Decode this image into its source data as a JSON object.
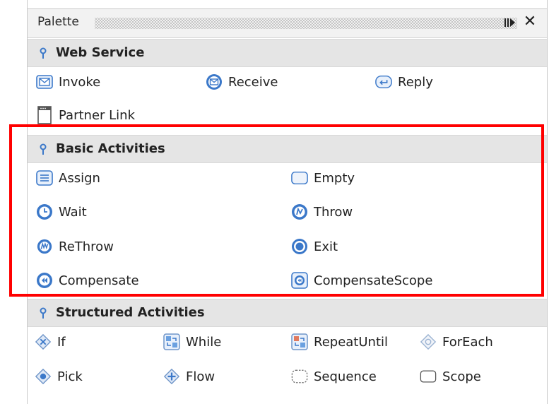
{
  "palette": {
    "title": "Palette",
    "categories": [
      {
        "label": "Web Service",
        "items": [
          {
            "label": "Invoke",
            "icon": "invoke-icon"
          },
          {
            "label": "Receive",
            "icon": "receive-icon"
          },
          {
            "label": "Reply",
            "icon": "reply-icon"
          },
          {
            "label": "Partner Link",
            "icon": "partner-link-icon"
          }
        ]
      },
      {
        "label": "Basic Activities",
        "items": [
          {
            "label": "Assign",
            "icon": "assign-icon"
          },
          {
            "label": "Empty",
            "icon": "empty-icon"
          },
          {
            "label": "Wait",
            "icon": "wait-icon"
          },
          {
            "label": "Throw",
            "icon": "throw-icon"
          },
          {
            "label": "ReThrow",
            "icon": "rethrow-icon"
          },
          {
            "label": "Exit",
            "icon": "exit-icon"
          },
          {
            "label": "Compensate",
            "icon": "compensate-icon"
          },
          {
            "label": "CompensateScope",
            "icon": "compensate-scope-icon"
          }
        ]
      },
      {
        "label": "Structured Activities",
        "items": [
          {
            "label": "If",
            "icon": "if-icon"
          },
          {
            "label": "While",
            "icon": "while-icon"
          },
          {
            "label": "RepeatUntil",
            "icon": "repeat-until-icon"
          },
          {
            "label": "ForEach",
            "icon": "foreach-icon"
          },
          {
            "label": "Pick",
            "icon": "pick-icon"
          },
          {
            "label": "Flow",
            "icon": "flow-icon"
          },
          {
            "label": "Sequence",
            "icon": "sequence-icon"
          },
          {
            "label": "Scope",
            "icon": "scope-icon"
          }
        ]
      }
    ]
  },
  "colors": {
    "highlight": "#ff0000",
    "header_bg": "#e5e5e5",
    "icon_blue": "#3b78c9"
  }
}
